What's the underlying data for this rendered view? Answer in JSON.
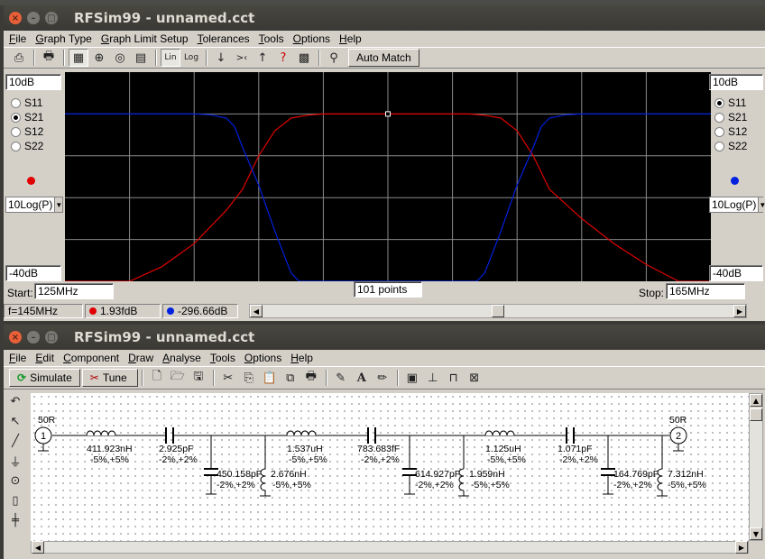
{
  "graph_window": {
    "title": "RFSim99 - unnamed.cct",
    "menu": [
      "File",
      "Graph Type",
      "Graph Limit Setup",
      "Tolerances",
      "Tools",
      "Options",
      "Help"
    ],
    "auto_match_label": "Auto Match",
    "left_panel": {
      "top_value": "10dB",
      "bottom_value": "-40dB",
      "params": [
        "S11",
        "S21",
        "S12",
        "S22"
      ],
      "selected": "S21",
      "marker_color": "#e00000",
      "scale": "10Log(P)"
    },
    "right_panel": {
      "top_value": "10dB",
      "bottom_value": "-40dB",
      "params": [
        "S11",
        "S21",
        "S12",
        "S22"
      ],
      "selected": "S11",
      "marker_color": "#0020e0",
      "scale": "10Log(P)"
    },
    "start_label": "Start:",
    "start_value": "125MHz",
    "points": "101 points",
    "stop_label": "Stop:",
    "stop_value": "165MHz",
    "status": {
      "freq": "f=145MHz",
      "s21_value": "1.93fdB",
      "s11_value": "-296.66dB"
    }
  },
  "chart_data": {
    "type": "line",
    "x_range": [
      125,
      165
    ],
    "ylim": [
      -40,
      10
    ],
    "grid": true,
    "series": [
      {
        "color": "#e00000",
        "x": [
          125,
          127,
          129,
          131,
          133,
          135,
          136,
          137,
          138,
          139,
          140,
          141,
          142,
          143,
          144,
          145,
          146,
          147,
          148,
          149,
          150,
          151,
          152,
          153,
          154,
          155,
          157,
          159,
          161,
          163,
          165
        ],
        "y": [
          -40,
          -40,
          -40,
          -36.5,
          -31,
          -23,
          -18,
          -10,
          -4,
          -1,
          -0.3,
          0,
          0,
          0,
          0,
          0,
          0,
          0,
          0,
          0,
          0,
          -0.3,
          -1,
          -4,
          -10,
          -18,
          -25,
          -31,
          -36,
          -40,
          -40
        ]
      },
      {
        "color": "#0020e0",
        "x": [
          125,
          130,
          133,
          134,
          135,
          135.5,
          136,
          137,
          138,
          139,
          139.5,
          150.5,
          151,
          152,
          153,
          154,
          154.5,
          155,
          156,
          157,
          160,
          165
        ],
        "y": [
          0,
          0,
          0,
          -0.2,
          -1,
          -3,
          -8,
          -17,
          -28,
          -38,
          -40,
          -40,
          -38,
          -28,
          -17,
          -8,
          -3,
          -1,
          -0.2,
          0,
          0,
          0
        ]
      }
    ]
  },
  "schematic_window": {
    "title": "RFSim99 - unnamed.cct",
    "menu": [
      "File",
      "Edit",
      "Component",
      "Draw",
      "Analyse",
      "Tools",
      "Options",
      "Help"
    ],
    "simulate_label": "Simulate",
    "tune_label": "Tune",
    "ports": [
      {
        "num": "1",
        "impedance": "50R"
      },
      {
        "num": "2",
        "impedance": "50R"
      }
    ],
    "series_components": [
      {
        "value": "411.923nH",
        "tol": "-5%,+5%"
      },
      {
        "value": "2.925pF",
        "tol": "-2%,+2%"
      },
      {
        "value": "1.537uH",
        "tol": "-5%,+5%"
      },
      {
        "value": "783.683fF",
        "tol": "-2%,+2%"
      },
      {
        "value": "1.125uH",
        "tol": "-5%,+5%"
      },
      {
        "value": "1.071pF",
        "tol": "-2%,+2%"
      }
    ],
    "shunt_components": [
      {
        "cap": "450.158pF",
        "cap_tol": "-2%,+2%",
        "ind": "2.676nH",
        "ind_tol": "-5%,+5%"
      },
      {
        "cap": "614.927pF",
        "cap_tol": "-2%,+2%",
        "ind": "1.959nH",
        "ind_tol": "-5%,+5%"
      },
      {
        "cap": "164.769pF",
        "cap_tol": "-2%,+2%",
        "ind": "7.312nH",
        "ind_tol": "-5%,+5%"
      }
    ]
  }
}
